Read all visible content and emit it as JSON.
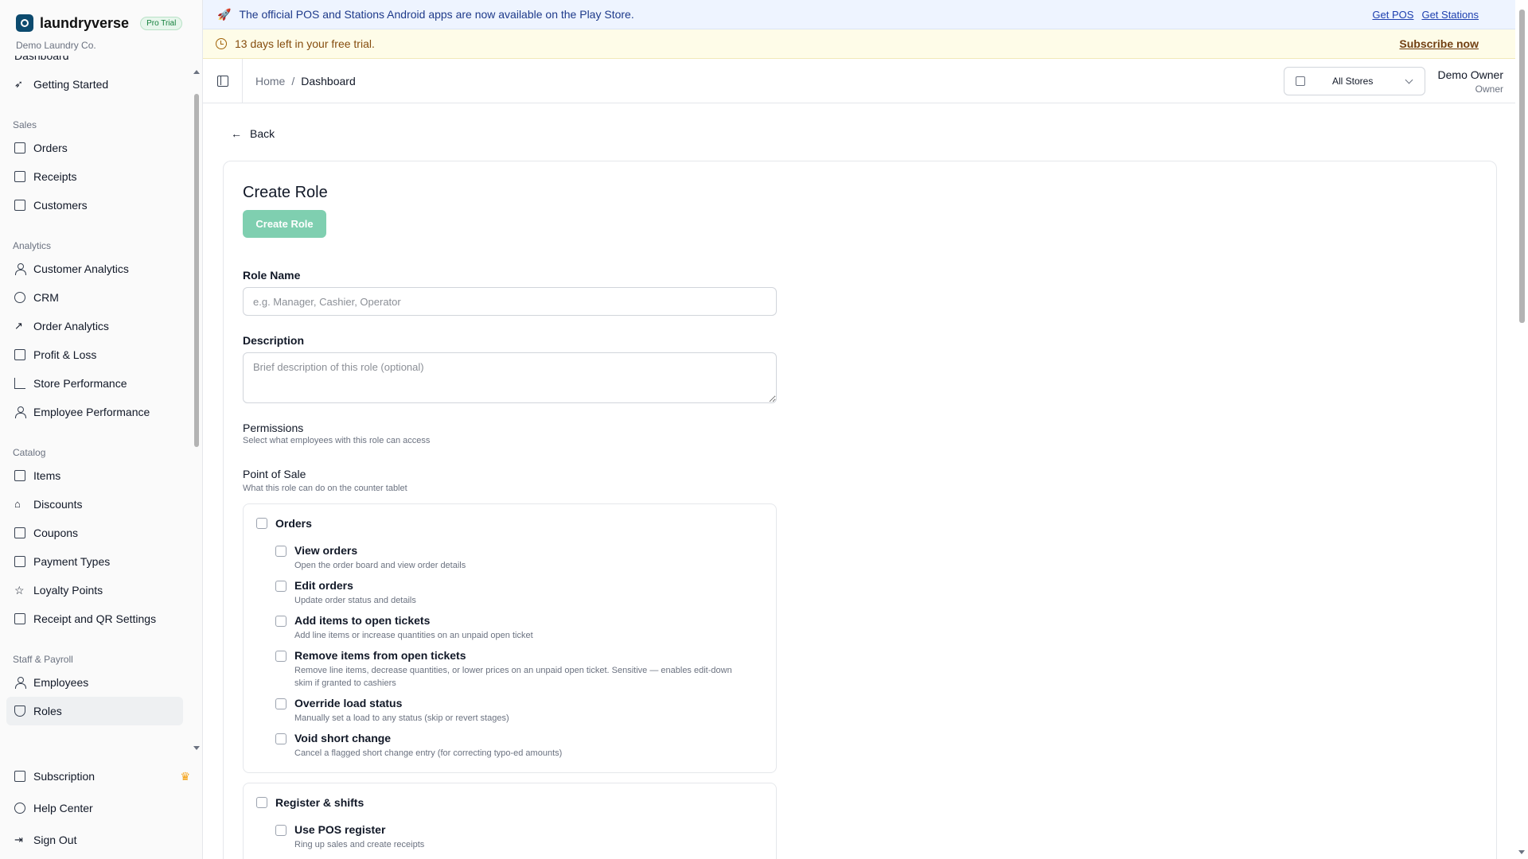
{
  "brand": {
    "name": "laundryverse",
    "badge": "Pro Trial",
    "company": "Demo Laundry Co."
  },
  "sidebar": {
    "cut_item": "Dashboard",
    "top_items": [
      {
        "label": "Getting Started",
        "icon": "rocket-icon"
      }
    ],
    "sections": [
      {
        "title": "Sales",
        "items": [
          {
            "label": "Orders",
            "icon": "clipboard-icon"
          },
          {
            "label": "Receipts",
            "icon": "receipt-icon"
          },
          {
            "label": "Customers",
            "icon": "contact-icon"
          }
        ]
      },
      {
        "title": "Analytics",
        "items": [
          {
            "label": "Customer Analytics",
            "icon": "users-icon"
          },
          {
            "label": "CRM",
            "icon": "target-icon"
          },
          {
            "label": "Order Analytics",
            "icon": "trending-icon"
          },
          {
            "label": "Profit & Loss",
            "icon": "banknote-icon"
          },
          {
            "label": "Store Performance",
            "icon": "bar-chart-icon"
          },
          {
            "label": "Employee Performance",
            "icon": "user-check-icon"
          }
        ]
      },
      {
        "title": "Catalog",
        "items": [
          {
            "label": "Items",
            "icon": "package-icon"
          },
          {
            "label": "Discounts",
            "icon": "tag-icon"
          },
          {
            "label": "Coupons",
            "icon": "ticket-icon"
          },
          {
            "label": "Payment Types",
            "icon": "wallet-icon"
          },
          {
            "label": "Loyalty Points",
            "icon": "star-icon"
          },
          {
            "label": "Receipt and QR Settings",
            "icon": "printer-icon"
          }
        ]
      },
      {
        "title": "Staff & Payroll",
        "items": [
          {
            "label": "Employees",
            "icon": "users-icon"
          },
          {
            "label": "Roles",
            "icon": "shield-icon",
            "active": true
          }
        ]
      }
    ],
    "bottom": [
      {
        "label": "Subscription",
        "icon": "credit-card-icon"
      },
      {
        "label": "Help Center",
        "icon": "help-circle-icon"
      },
      {
        "label": "Sign Out",
        "icon": "log-out-icon"
      }
    ]
  },
  "banner": {
    "message": "The official POS and Stations Android apps are now available on the Play Store.",
    "link_pos": "Get POS",
    "link_stations": "Get Stations",
    "trial": "13 days left in your free trial.",
    "subscribe": "Subscribe now"
  },
  "header": {
    "crumb_home": "Home",
    "crumb_sep": "/",
    "crumb_current": "Dashboard",
    "store_select": "All Stores",
    "user_name": "Demo Owner",
    "user_role": "Owner"
  },
  "page": {
    "back": "Back",
    "title": "Create Role",
    "create_button": "Create Role",
    "role_name_label": "Role Name",
    "role_name_placeholder": "e.g. Manager, Cashier, Operator",
    "description_label": "Description",
    "description_placeholder": "Brief description of this role (optional)",
    "permissions_title": "Permissions",
    "permissions_sub": "Select what employees with this role can access",
    "pos_title": "Point of Sale",
    "pos_sub": "What this role can do on the counter tablet"
  },
  "groups": [
    {
      "title": "Orders",
      "items": [
        {
          "title": "View orders",
          "desc": "Open the order board and view order details"
        },
        {
          "title": "Edit orders",
          "desc": "Update order status and details"
        },
        {
          "title": "Add items to open tickets",
          "desc": "Add line items or increase quantities on an unpaid open ticket"
        },
        {
          "title": "Remove items from open tickets",
          "desc": "Remove line items, decrease quantities, or lower prices on an unpaid open ticket. Sensitive — enables edit-down skim if granted to cashiers"
        },
        {
          "title": "Override load status",
          "desc": "Manually set a load to any status (skip or revert stages)"
        },
        {
          "title": "Void short change",
          "desc": "Cancel a flagged short change entry (for correcting typo-ed amounts)"
        }
      ]
    },
    {
      "title": "Register & shifts",
      "items": [
        {
          "title": "Use POS register",
          "desc": "Ring up sales and create receipts"
        }
      ]
    }
  ]
}
